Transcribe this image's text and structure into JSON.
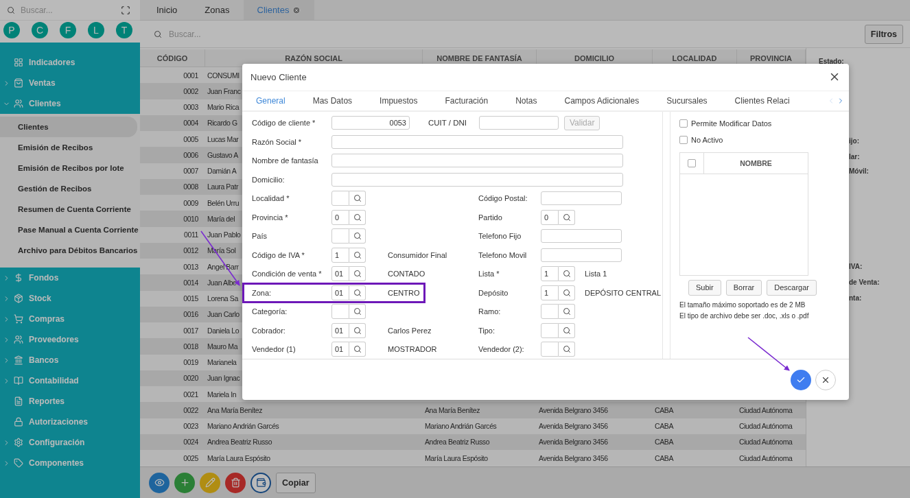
{
  "sidebar": {
    "search_placeholder": "Buscar...",
    "shortcuts": [
      "P",
      "C",
      "F",
      "L",
      "T"
    ],
    "menu": [
      {
        "label": "Indicadores",
        "expandable": false
      },
      {
        "label": "Ventas",
        "expandable": true,
        "expanded": false
      },
      {
        "label": "Clientes",
        "expandable": true,
        "expanded": true,
        "children": [
          {
            "label": "Clientes",
            "selected": true
          },
          {
            "label": "Emisión de Recibos",
            "selected": false
          },
          {
            "label": "Emisión de Recibos por lote",
            "selected": false
          },
          {
            "label": "Gestión de Recibos",
            "selected": false
          },
          {
            "label": "Resumen de Cuenta Corriente",
            "selected": false
          },
          {
            "label": "Pase Manual a Cuenta Corriente",
            "selected": false
          },
          {
            "label": "Archivo para Débitos Bancarios",
            "selected": false
          }
        ]
      },
      {
        "label": "Fondos",
        "expandable": true,
        "expanded": false
      },
      {
        "label": "Stock",
        "expandable": true,
        "expanded": false
      },
      {
        "label": "Compras",
        "expandable": true,
        "expanded": false
      },
      {
        "label": "Proveedores",
        "expandable": true,
        "expanded": false
      },
      {
        "label": "Bancos",
        "expandable": true,
        "expanded": false
      },
      {
        "label": "Contabilidad",
        "expandable": true,
        "expanded": false
      },
      {
        "label": "Reportes",
        "expandable": false
      },
      {
        "label": "Autorizaciones",
        "expandable": false
      },
      {
        "label": "Configuración",
        "expandable": true,
        "expanded": false
      },
      {
        "label": "Componentes",
        "expandable": true,
        "expanded": false
      }
    ]
  },
  "tabs": [
    {
      "label": "Inicio",
      "selected": false,
      "closable": false
    },
    {
      "label": "Zonas",
      "selected": false,
      "closable": false
    },
    {
      "label": "Clientes",
      "selected": true,
      "closable": true
    }
  ],
  "search": {
    "placeholder": "Buscar..."
  },
  "filter_button": "Filtros",
  "table": {
    "columns": [
      "CÓDIGO",
      "RAZÓN SOCIAL",
      "NOMBRE DE FANTASÍA",
      "DOMICILIO",
      "LOCALIDAD",
      "PROVINCIA"
    ],
    "rows": [
      {
        "cells": [
          "0001",
          "CONSUMI"
        ]
      },
      {
        "cells": [
          "0002",
          "Juan Franc"
        ]
      },
      {
        "cells": [
          "0003",
          "Mario Rica"
        ]
      },
      {
        "cells": [
          "0004",
          "Ricardo G"
        ]
      },
      {
        "cells": [
          "0005",
          "Lucas Mar"
        ]
      },
      {
        "cells": [
          "0006",
          "Gustavo A"
        ]
      },
      {
        "cells": [
          "0007",
          "Damián A"
        ]
      },
      {
        "cells": [
          "0008",
          "Laura Patr"
        ]
      },
      {
        "cells": [
          "0009",
          "Belén Urru"
        ]
      },
      {
        "cells": [
          "0010",
          "María del"
        ]
      },
      {
        "cells": [
          "0011",
          "Juan Pablo"
        ]
      },
      {
        "cells": [
          "0012",
          "María Sol"
        ]
      },
      {
        "cells": [
          "0013",
          "Angel Barr"
        ]
      },
      {
        "cells": [
          "0014",
          "Juan Albe"
        ]
      },
      {
        "cells": [
          "0015",
          "Lorena Sa"
        ]
      },
      {
        "cells": [
          "0016",
          "Juan Carlo"
        ]
      },
      {
        "cells": [
          "0017",
          "Daniela Lo"
        ]
      },
      {
        "cells": [
          "0018",
          "Mauro Ma"
        ]
      },
      {
        "cells": [
          "0019",
          "Marianela"
        ]
      },
      {
        "cells": [
          "0020",
          "Juan Ignac"
        ]
      },
      {
        "cells": [
          "0021",
          "Mariela In"
        ]
      },
      {
        "cells": [
          "0022",
          "Ana María Benítez",
          "Ana María Benítez",
          "Avenida Belgrano 3456",
          "CABA",
          "Ciudad Autónoma"
        ]
      },
      {
        "cells": [
          "0023",
          "Mariano Andrián Garcés",
          "Mariano Andrián Garcés",
          "Avenida Belgrano 3456",
          "CABA",
          "Ciudad Autónoma"
        ]
      },
      {
        "cells": [
          "0024",
          "Andrea Beatriz Russo",
          "Andrea Beatriz Russo",
          "Avenida Belgrano 3456",
          "CABA",
          "Ciudad Autónoma"
        ]
      },
      {
        "cells": [
          "0025",
          "María Laura Espósito",
          "María Laura Espósito",
          "Avenida Belgrano 3456",
          "CABA",
          "Ciudad Autónoma"
        ]
      }
    ]
  },
  "detail_panel": {
    "labels": [
      "Estado:",
      "ijo:",
      "lar:",
      "Móvil:",
      "IVA:",
      "de Venta:",
      "nta:"
    ]
  },
  "toolbar": {
    "buttons": [
      {
        "kind": "view"
      },
      {
        "kind": "add"
      },
      {
        "kind": "edit"
      },
      {
        "kind": "delete"
      },
      {
        "kind": "wallet"
      }
    ],
    "copy_button": "Copiar"
  },
  "modal": {
    "title": "Nuevo Cliente",
    "tabs": [
      {
        "label": "General",
        "selected": true
      },
      {
        "label": "Mas Datos",
        "selected": false
      },
      {
        "label": "Impuestos",
        "selected": false
      },
      {
        "label": "Facturación",
        "selected": false
      },
      {
        "label": "Notas",
        "selected": false
      },
      {
        "label": "Campos Adicionales",
        "selected": false
      },
      {
        "label": "Sucursales",
        "selected": false
      },
      {
        "label": "Clientes Relaci",
        "selected": false
      }
    ],
    "form": [
      {
        "kind": "code",
        "highlighted": false,
        "label": "Código de cliente *",
        "value": "0053",
        "extra_label": "CUIT / DNI",
        "button": {
          "label": "Validar",
          "disabled": true
        }
      },
      {
        "kind": "wide",
        "highlighted": false,
        "label": "Razón Social *"
      },
      {
        "kind": "wide",
        "highlighted": false,
        "label": "Nombre de fantasía"
      },
      {
        "kind": "wide",
        "highlighted": false,
        "label": "Domicilio:"
      },
      {
        "kind": "pair",
        "highlighted": false,
        "left": {
          "label": "Localidad *"
        },
        "right": {
          "kind": "input",
          "label": "Código Postal:"
        }
      },
      {
        "kind": "pair",
        "highlighted": false,
        "left": {
          "label": "Provincia *",
          "value": "0"
        },
        "right": {
          "kind": "lookup",
          "label": "Partido",
          "value": "0"
        }
      },
      {
        "kind": "pair",
        "highlighted": false,
        "left": {
          "label": "País"
        },
        "right": {
          "kind": "input",
          "label": "Telefono Fijo"
        }
      },
      {
        "kind": "pair",
        "highlighted": false,
        "left": {
          "label": "Código de IVA *",
          "value": "1",
          "description": "Consumidor Final"
        },
        "right": {
          "kind": "input",
          "label": "Telefono Movil"
        }
      },
      {
        "kind": "pair",
        "highlighted": false,
        "left": {
          "label": "Condición de venta *",
          "value": "01",
          "description": "CONTADO"
        },
        "right": {
          "kind": "lookup",
          "label": "Lista *",
          "value": "1",
          "description": "Lista 1"
        }
      },
      {
        "kind": "pair",
        "highlighted": true,
        "left": {
          "label": "Zona:",
          "value": "01",
          "description": "CENTRO"
        },
        "right": {
          "kind": "lookup",
          "label": "Depósito",
          "value": "1",
          "description": "DEPÓSITO CENTRAL"
        }
      },
      {
        "kind": "pair",
        "highlighted": false,
        "left": {
          "label": "Categoría:"
        },
        "right": {
          "kind": "lookup",
          "label": "Ramo:"
        }
      },
      {
        "kind": "pair",
        "highlighted": false,
        "left": {
          "label": "Cobrador:",
          "value": "01",
          "description": "Carlos Perez"
        },
        "right": {
          "kind": "lookup",
          "label": "Tipo:"
        }
      },
      {
        "kind": "pair",
        "highlighted": false,
        "left": {
          "label": "Vendedor (1)",
          "value": "01",
          "description": "MOSTRADOR"
        },
        "right": {
          "kind": "lookup",
          "label": "Vendedor (2):"
        }
      }
    ],
    "side": {
      "checkboxes": [
        {
          "label": "Permite Modificar Datos",
          "checked": false
        },
        {
          "label": "No Activo",
          "checked": false
        }
      ],
      "list_header": "NOMBRE",
      "header_checked": false,
      "buttons": [
        "Subir",
        "Borrar",
        "Descargar"
      ],
      "notes": [
        "El tamaño máximo soportado es de 2 MB",
        "El tipo de archivo debe ser .doc, .xls o .pdf"
      ]
    }
  }
}
